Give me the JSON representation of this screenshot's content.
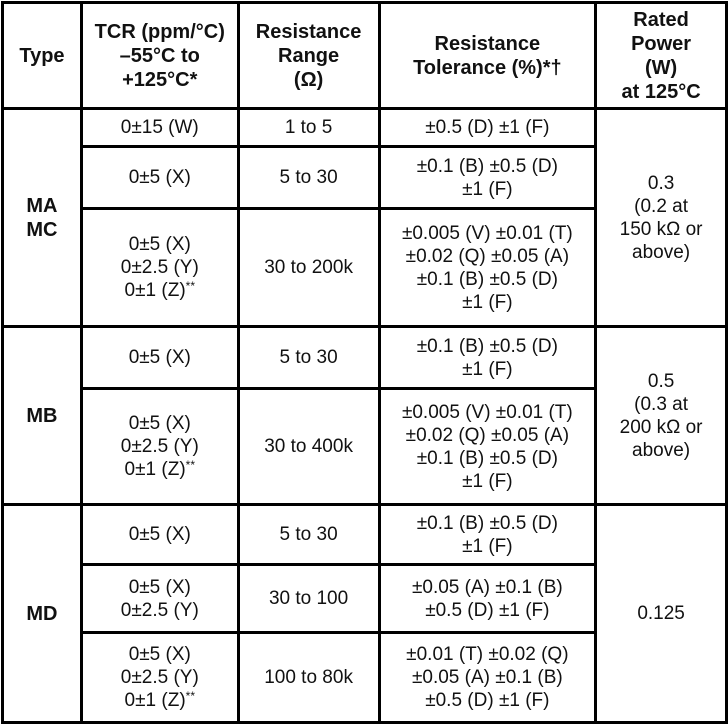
{
  "table": {
    "headers": [
      {
        "key": "type",
        "label": "Type"
      },
      {
        "key": "tcr",
        "label": "TCR (ppm/°C)\n–55°C to\n+125°C*"
      },
      {
        "key": "range",
        "label": "Resistance\nRange\n(Ω)"
      },
      {
        "key": "tolerance",
        "label": "Resistance\nTolerance (%)*†"
      },
      {
        "key": "power",
        "label": "Rated\nPower\n(W)\nat 125°C"
      }
    ],
    "groups": [
      {
        "type": "MA\nMC",
        "power": "0.3\n(0.2 at\n150 kΩ or\nabove)",
        "rows": [
          {
            "tcr": "0±15 (W)",
            "range": "1 to 5",
            "tolerance": "±0.5 (D) ±1 (F)"
          },
          {
            "tcr": "0±5 (X)",
            "range": "5 to 30",
            "tolerance": "±0.1 (B) ±0.5 (D)\n±1 (F)"
          },
          {
            "tcr": "0±5 (X)\n0±2.5 (Y)\n0±1 (Z)**",
            "range": "30 to 200k",
            "tolerance": "±0.005 (V) ±0.01 (T)\n±0.02 (Q) ±0.05 (A)\n±0.1 (B) ±0.5 (D)\n±1 (F)"
          }
        ]
      },
      {
        "type": "MB",
        "power": "0.5\n(0.3 at\n200 kΩ or\nabove)",
        "rows": [
          {
            "tcr": "0±5 (X)",
            "range": "5 to 30",
            "tolerance": "±0.1 (B) ±0.5 (D)\n±1 (F)"
          },
          {
            "tcr": "0±5 (X)\n0±2.5 (Y)\n0±1 (Z)**",
            "range": "30 to 400k",
            "tolerance": "±0.005 (V) ±0.01 (T)\n±0.02 (Q) ±0.05 (A)\n±0.1 (B) ±0.5 (D)\n±1 (F)"
          }
        ]
      },
      {
        "type": "MD",
        "power": "0.125",
        "rows": [
          {
            "tcr": "0±5 (X)",
            "range": "5 to 30",
            "tolerance": "±0.1 (B) ±0.5 (D)\n±1 (F)"
          },
          {
            "tcr": "0±5 (X)\n0±2.5 (Y)",
            "range": "30 to 100",
            "tolerance": "±0.05 (A) ±0.1 (B)\n±0.5 (D) ±1 (F)"
          },
          {
            "tcr": "0±5 (X)\n0±2.5 (Y)\n0±1 (Z)**",
            "range": "100 to 80k",
            "tolerance": "±0.01 (T) ±0.02 (Q)\n±0.05 (A) ±0.1 (B)\n±0.5 (D) ±1 (F)"
          }
        ]
      }
    ]
  }
}
